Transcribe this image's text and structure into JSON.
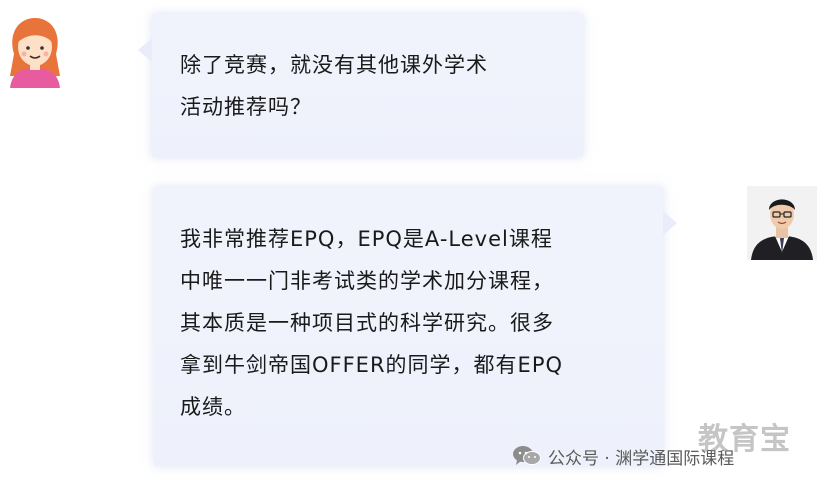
{
  "question": {
    "avatar_icon": "cartoon-girl-avatar",
    "lines": [
      "除了竞赛，就没有其他课外学术",
      "活动推荐吗？"
    ]
  },
  "answer": {
    "avatar_icon": "teacher-photo-avatar",
    "lines": [
      "我非常推荐EPQ，EPQ是A-Level课程",
      "中唯一一门非考试类的学术加分课程，",
      "其本质是一种项目式的科学研究。很多",
      "拿到牛剑帝国OFFER的同学，都有EPQ",
      "成绩。"
    ]
  },
  "footer": {
    "icon": "wechat-icon",
    "label": "公众号 · 渊学通国际课程"
  },
  "watermark": "教育宝",
  "colors": {
    "bubble_bg": "#eef1fb",
    "hair": "#e8743b",
    "shirt": "#e85c9f",
    "skin": "#fde0c6"
  }
}
